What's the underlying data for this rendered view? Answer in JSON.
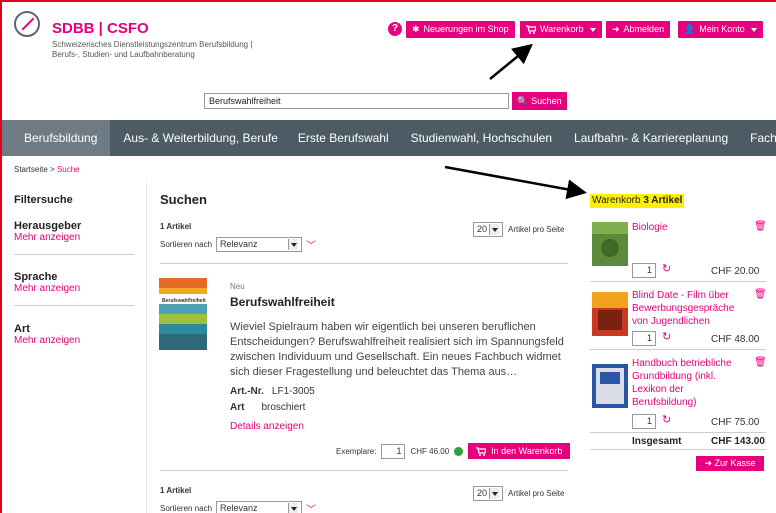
{
  "header": {
    "brand": "SDBB | CSFO",
    "subtitle_line1": "Schweizerisches Dienstleistungszentrum Berufsbildung |",
    "subtitle_line2": "Berufs-, Studien- und Laufbahnberatung",
    "buttons": {
      "news": "Neuerungen im Shop",
      "cart": "Warenkorb",
      "logout": "Abmelden",
      "account": "Mein Konto"
    }
  },
  "search": {
    "value": "Berufswahlfreiheit",
    "button": "Suchen"
  },
  "nav": [
    "Berufsbildung",
    "Aus- & Weiterbildung, Berufe",
    "Erste Berufswahl",
    "Studienwahl, Hochschulen",
    "Laufbahn- & Karriereplanung",
    "Fachpersonen"
  ],
  "breadcrumb": {
    "home": "Startseite",
    "sep": ">",
    "current": "Suche"
  },
  "filters": {
    "title": "Filtersuche",
    "groups": [
      {
        "label": "Herausgeber",
        "more": "Mehr anzeigen"
      },
      {
        "label": "Sprache",
        "more": "Mehr anzeigen"
      },
      {
        "label": "Art",
        "more": "Mehr anzeigen"
      }
    ]
  },
  "results": {
    "title": "Suchen",
    "count": "1 Artikel",
    "sort_label": "Sortieren nach",
    "sort_value": "Relevanz",
    "per_page": "20",
    "per_page_label": "Artikel pro Seite",
    "item": {
      "badge": "Neu",
      "title": "Berufswahlfreiheit",
      "cover_title": "Berufswahlfreiheit",
      "description": "Wieviel Spielraum haben wir eigentlich bei unseren beruflichen Entscheidungen? Berufswahlfreiheit realisiert sich im Spannungsfeld zwischen Individuum und Gesellschaft. Ein neues Fachbuch widmet sich dieser Fragestellung und beleuchtet das Thema aus…",
      "artnr_label": "Art.-Nr.",
      "artnr": "LF1-3005",
      "art_label": "Art",
      "art": "broschiert",
      "details": "Details anzeigen",
      "qty_label": "Exemplare:",
      "qty": "1",
      "price": "CHF 46.00",
      "add_button": "In den Warenkorb"
    }
  },
  "cart": {
    "title": "Warenkorb",
    "count": "3 Artikel",
    "items": [
      {
        "name": "Biologie",
        "qty": "1",
        "price": "CHF  20.00"
      },
      {
        "name": "Blind Date - Film über Bewerbungsgespräche von Jugendlichen",
        "qty": "1",
        "price": "CHF  48.00"
      },
      {
        "name": "Handbuch betriebliche Grundbildung (inkl. Lexikon der Berufsbildung)",
        "qty": "1",
        "price": "CHF  75.00"
      }
    ],
    "total_label": "Insgesamt",
    "total": "CHF 143.00",
    "checkout": "Zur Kasse"
  },
  "colors": {
    "accent": "#e6007e",
    "nav": "#4d5b65",
    "highlight": "#ffef00",
    "frame": "#e3001b"
  }
}
